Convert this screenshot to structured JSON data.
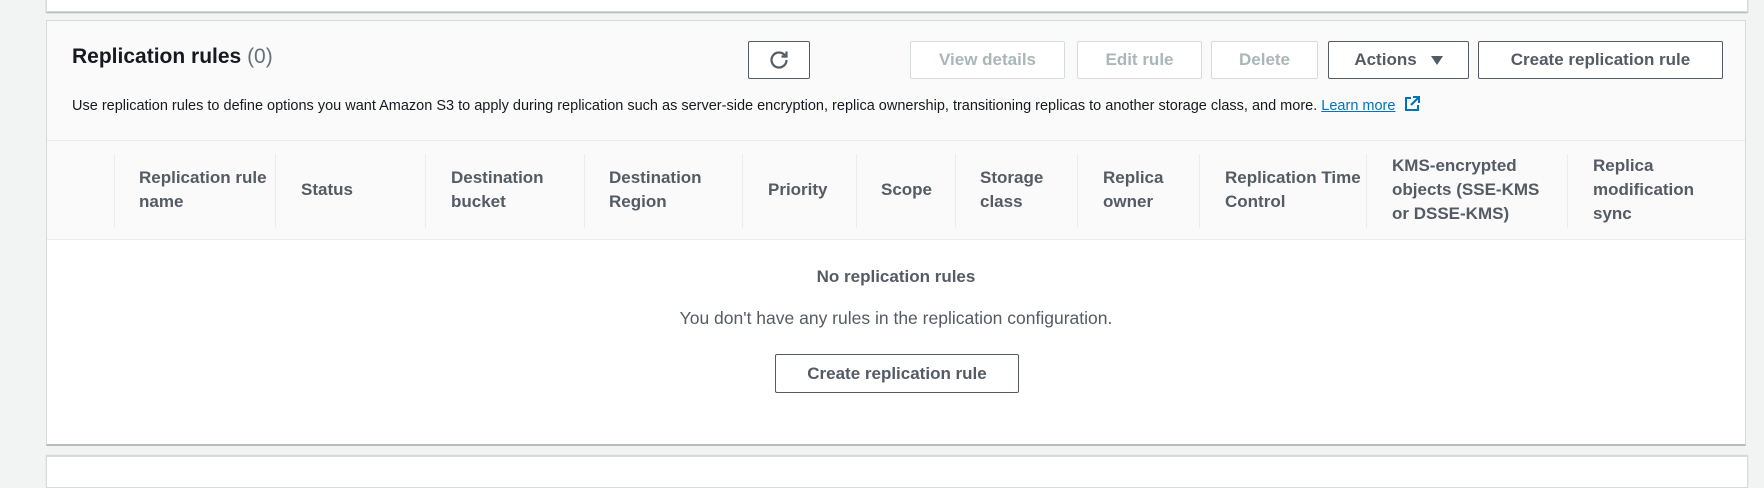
{
  "section": {
    "title": "Replication rules",
    "count": "(0)",
    "description": "Use replication rules to define options you want Amazon S3 to apply during replication such as server-side encryption, replica ownership, transitioning replicas to another storage class, and more.",
    "learn_more": "Learn more"
  },
  "toolbar": {
    "refresh_icon": "refresh-icon",
    "view_details": "View details",
    "edit_rule": "Edit rule",
    "delete": "Delete",
    "actions": "Actions",
    "create_rule": "Create replication rule"
  },
  "table": {
    "columns": [
      "Replication rule name",
      "Status",
      "Destination bucket",
      "Destination Region",
      "Priority",
      "Scope",
      "Storage class",
      "Replica owner",
      "Replication Time Control",
      "KMS-encrypted objects (SSE-KMS or DSSE-KMS)",
      "Replica modification sync"
    ],
    "rows": []
  },
  "empty_state": {
    "title": "No replication rules",
    "description": "You don't have any rules in the replication configuration.",
    "button": "Create replication rule"
  },
  "colors": {
    "accent_link": "#0073bb",
    "text_primary": "#16191f",
    "text_secondary": "#545b64",
    "disabled": "#aab7b8"
  }
}
